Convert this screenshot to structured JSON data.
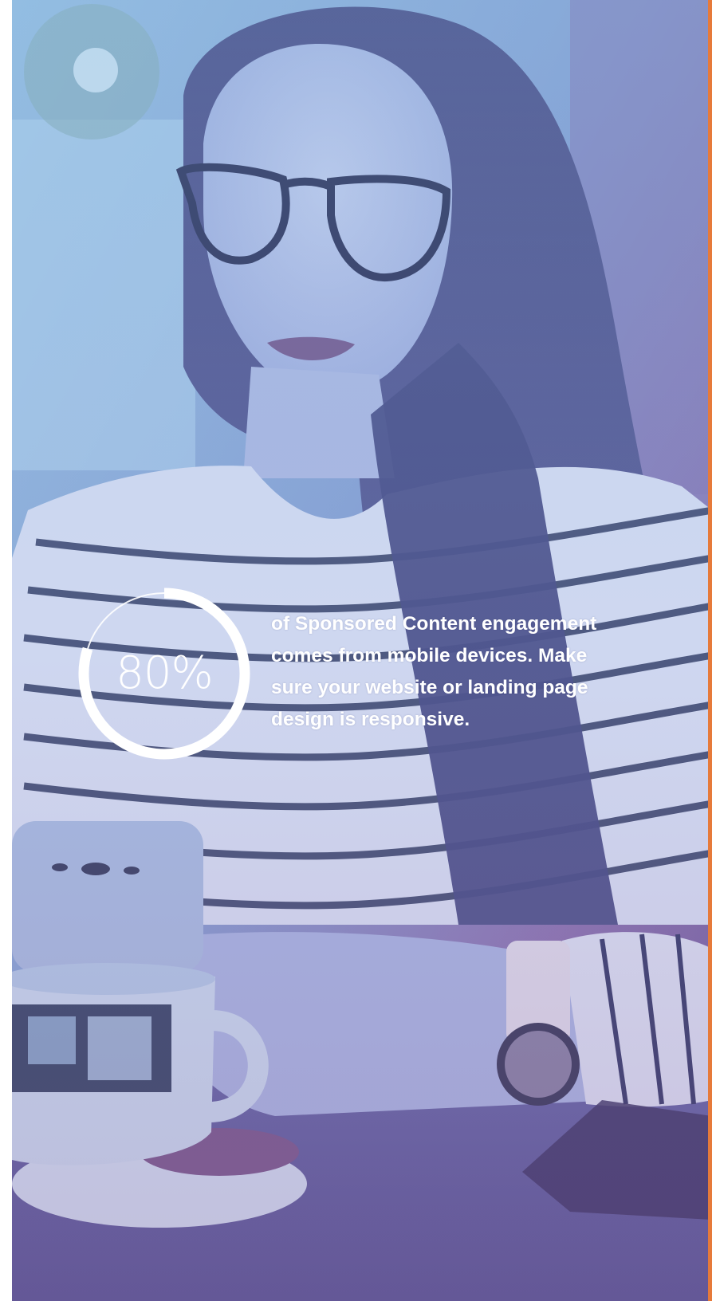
{
  "stat": {
    "percent": 80,
    "value_label": "80%",
    "description": "of Sponsored Content engagement comes from mobile devices. Make sure your website or landing page design is responsive."
  },
  "colors": {
    "accent_edge": "#e67a3a",
    "ring": "#ffffff",
    "text": "#ffffff"
  },
  "icons": {
    "ring": "progress-ring-icon"
  }
}
